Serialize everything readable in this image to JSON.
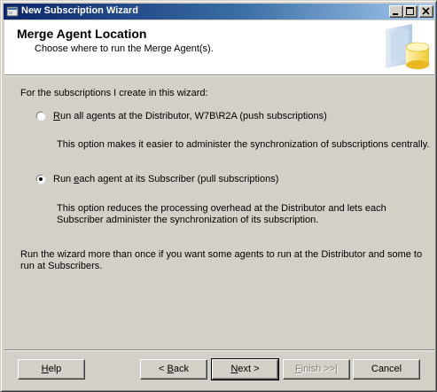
{
  "window": {
    "title": "New Subscription Wizard"
  },
  "header": {
    "title": "Merge Agent Location",
    "subtitle": "Choose where to run the Merge Agent(s)."
  },
  "content": {
    "intro": "For the subscriptions I create in this wizard:",
    "options": [
      {
        "accel": "R",
        "label_rest": "un all agents at the Distributor, W7B\\R2A (push subscriptions)",
        "selected": false,
        "description_lines": [
          "This option makes it easier to administer the synchronization of subscriptions centrally."
        ]
      },
      {
        "label_pre": "Run ",
        "accel": "e",
        "label_rest": "ach agent at its Subscriber (pull subscriptions)",
        "selected": true,
        "description_lines": [
          "This option reduces the processing overhead at the Distributor and lets each",
          "Subscriber administer the synchronization of its subscription."
        ]
      }
    ],
    "footer_note_lines": [
      "Run the wizard more than once if you want some agents to run at the Distributor and some to",
      "run at Subscribers."
    ]
  },
  "buttons": {
    "help": {
      "accel": "H",
      "rest": "elp"
    },
    "back": {
      "pre": "< ",
      "accel": "B",
      "rest": "ack"
    },
    "next": {
      "accel": "N",
      "rest": "ext >"
    },
    "finish": {
      "accel": "F",
      "rest": "inish >>|",
      "disabled": true
    },
    "cancel": {
      "label": "Cancel"
    }
  }
}
